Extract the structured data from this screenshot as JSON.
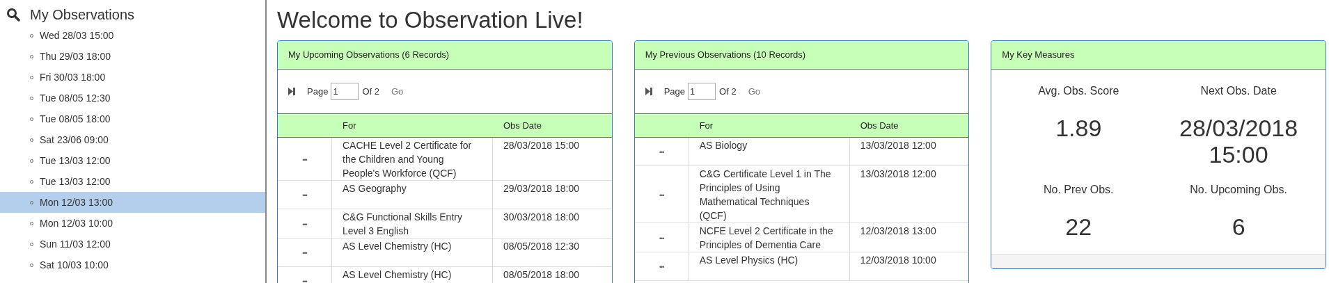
{
  "sidebar": {
    "title": "My Observations",
    "items": [
      {
        "label": "Wed 28/03 15:00",
        "selected": false
      },
      {
        "label": "Thu 29/03 18:00",
        "selected": false
      },
      {
        "label": "Fri 30/03 18:00",
        "selected": false
      },
      {
        "label": "Tue 08/05 12:30",
        "selected": false
      },
      {
        "label": "Tue 08/05 18:00",
        "selected": false
      },
      {
        "label": "Sat 23/06 09:00",
        "selected": false
      },
      {
        "label": "Tue 13/03 12:00",
        "selected": false
      },
      {
        "label": "Tue 13/03 12:00",
        "selected": false
      },
      {
        "label": "Mon 12/03 13:00",
        "selected": true
      },
      {
        "label": "Mon 12/03 10:00",
        "selected": false
      },
      {
        "label": "Sun 11/03 12:00",
        "selected": false
      },
      {
        "label": "Sat 10/03 10:00",
        "selected": false
      }
    ]
  },
  "title": "Welcome to Observation Live!",
  "panels": [
    {
      "kind": "table",
      "title": "My Upcoming Observations (6 Records)",
      "pager": {
        "label": "Page",
        "value": "1",
        "of": "Of 2",
        "go": "Go"
      },
      "columns": [
        "For",
        "Obs Date"
      ],
      "rows": [
        {
          "menu": "•••",
          "for": "CACHE Level 2 Certificate for the Children and Young People's Workforce (QCF)",
          "date": "28/03/2018 15:00"
        },
        {
          "menu": "•••",
          "for": "AS Geography",
          "date": "29/03/2018 18:00"
        },
        {
          "menu": "•••",
          "for": "C&G Functional Skills Entry Level 3 English",
          "date": "30/03/2018 18:00"
        },
        {
          "menu": "•••",
          "for": "AS Level Chemistry (HC)",
          "date": "08/05/2018 12:30"
        },
        {
          "menu": "•••",
          "for": "AS Level Chemistry (HC)",
          "date": "08/05/2018 18:00"
        }
      ]
    },
    {
      "kind": "table",
      "title": "My Previous Observations (10 Records)",
      "pager": {
        "label": "Page",
        "value": "1",
        "of": "Of 2",
        "go": "Go"
      },
      "columns": [
        "For",
        "Obs Date"
      ],
      "rows": [
        {
          "menu": "•••",
          "for": "AS Biology",
          "date": "13/03/2018 12:00"
        },
        {
          "menu": "•••",
          "for": "C&G Certificate Level 1 in The Principles of Using Mathematical Techniques (QCF)",
          "date": "13/03/2018 12:00"
        },
        {
          "menu": "•••",
          "for": "NCFE Level 2 Certificate in the Principles of Dementia Care",
          "date": "12/03/2018 13:00"
        },
        {
          "menu": "•••",
          "for": "AS Level Physics (HC)",
          "date": "12/03/2018 10:00"
        }
      ]
    },
    {
      "kind": "measures",
      "title": "My Key Measures",
      "measures": [
        {
          "label": "Avg. Obs. Score",
          "value": "1.89"
        },
        {
          "label": "Next Obs. Date",
          "value": "28/03/2018 15:00"
        },
        {
          "label": "No. Prev Obs.",
          "value": "22"
        },
        {
          "label": "No. Upcoming Obs.",
          "value": "6"
        }
      ]
    }
  ]
}
